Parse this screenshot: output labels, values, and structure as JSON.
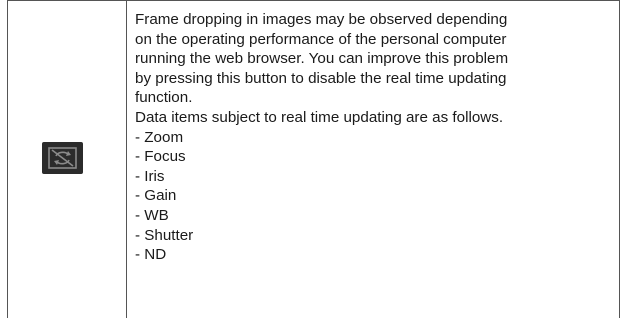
{
  "row": {
    "icon": "realtime-update-disable-icon",
    "description_lines": [
      "Frame dropping in images may be observed depending",
      "on the operating performance of the personal computer",
      "running the web browser. You can improve this problem",
      "by pressing this button to disable the real time updating",
      "function."
    ],
    "items_intro": "Data items subject to real time updating are as follows.",
    "items": [
      "- Zoom",
      "- Focus",
      "- Iris",
      "- Gain",
      "- WB",
      "- Shutter",
      "- ND"
    ]
  }
}
